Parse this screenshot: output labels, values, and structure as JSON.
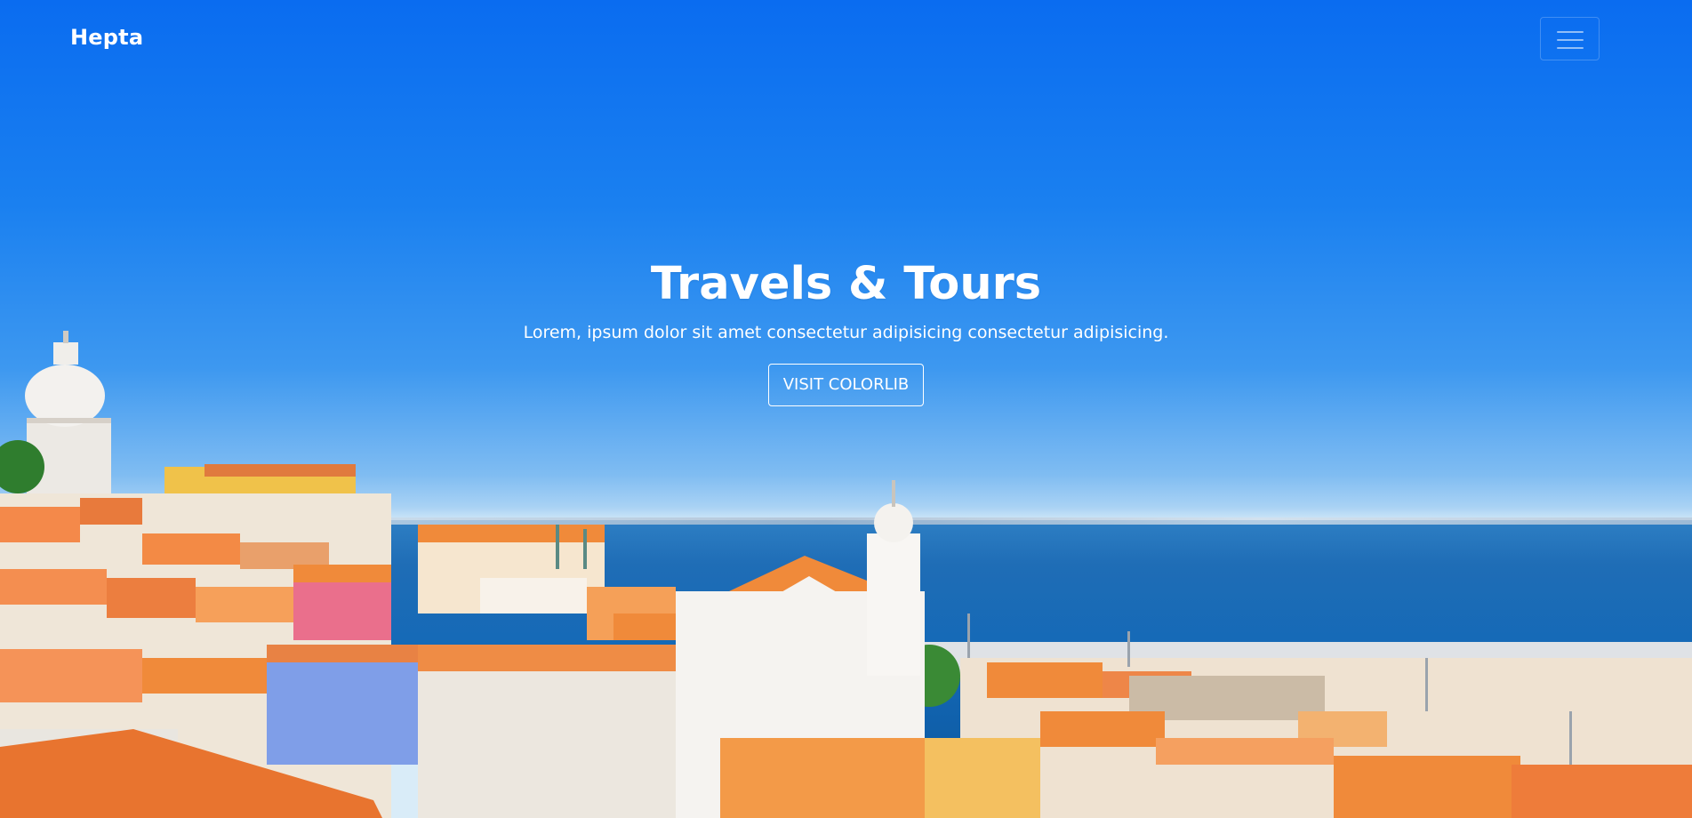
{
  "navbar": {
    "brand": "Hepta",
    "toggle_icon": "hamburger-menu-icon"
  },
  "hero": {
    "title": "Travels & Tours",
    "subtitle": "Lorem, ipsum dolor sit amet consectetur adipisicing consectetur adipisicing.",
    "button_label": "VISIT COLORLIB"
  },
  "colors": {
    "sky_top": "#0a6cf0",
    "sky_horizon": "#d9ecf8",
    "sea": "#1469b7",
    "roof": "#f08a3a",
    "text": "#ffffff"
  }
}
